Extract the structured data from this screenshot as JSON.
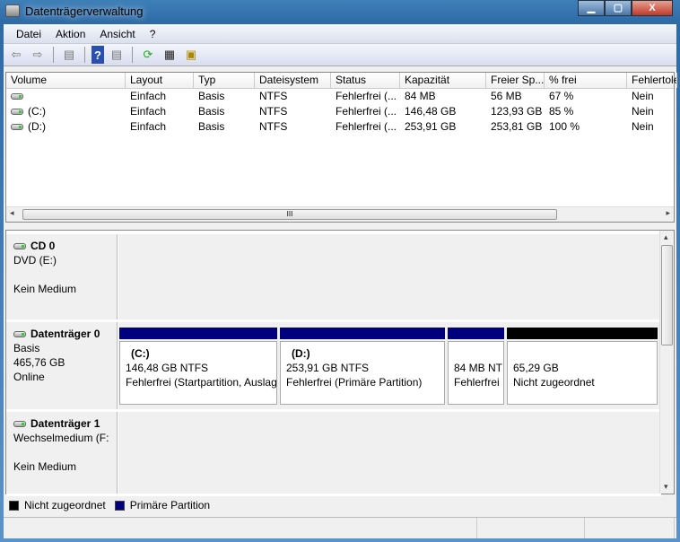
{
  "window": {
    "title": "Datenträgerverwaltung",
    "minimize": "▁",
    "maximize": "▢",
    "close": "X"
  },
  "menu": [
    "Datei",
    "Aktion",
    "Ansicht",
    "?"
  ],
  "toolbar": [
    "back-icon",
    "forward-icon",
    "show-hide-console-tree-icon",
    "help-icon",
    "show-hide-action-pane-icon",
    "refresh-icon",
    "properties-icon",
    "settings-icon"
  ],
  "table": {
    "columns": [
      "Volume",
      "Layout",
      "Typ",
      "Dateisystem",
      "Status",
      "Kapazität",
      "Freier Sp...",
      "% frei",
      "Fehlertole"
    ],
    "rows": [
      [
        "",
        "Einfach",
        "Basis",
        "NTFS",
        "Fehlerfrei (...",
        "84 MB",
        "56 MB",
        "67 %",
        "Nein"
      ],
      [
        "(C:)",
        "Einfach",
        "Basis",
        "NTFS",
        "Fehlerfrei (...",
        "146,48 GB",
        "123,93 GB",
        "85 %",
        "Nein"
      ],
      [
        "(D:)",
        "Einfach",
        "Basis",
        "NTFS",
        "Fehlerfrei (...",
        "253,91 GB",
        "253,81 GB",
        "100 %",
        "Nein"
      ]
    ],
    "scroll_grip": "III"
  },
  "disks": [
    {
      "name": "CD 0",
      "lines": [
        "DVD (E:)",
        "",
        "Kein Medium"
      ],
      "partitions": []
    },
    {
      "name": "Datenträger 0",
      "lines": [
        "Basis",
        "465,76 GB",
        "Online"
      ],
      "partitions": [
        {
          "label": "(C:)",
          "size": "146,48 GB NTFS",
          "status": "Fehlerfrei (Startpartition, Auslag",
          "color": "#00007f"
        },
        {
          "label": "(D:)",
          "size": "253,91 GB NTFS",
          "status": "Fehlerfrei (Primäre Partition)",
          "color": "#00007f"
        },
        {
          "label": "",
          "size": "84 MB NT",
          "status": "Fehlerfrei",
          "color": "#00007f"
        },
        {
          "label": "",
          "size": "65,29 GB",
          "status": "Nicht zugeordnet",
          "color": "#000000"
        }
      ]
    },
    {
      "name": "Datenträger 1",
      "lines": [
        "Wechselmedium (F:",
        "",
        "Kein Medium"
      ],
      "partitions": []
    }
  ],
  "legend": [
    {
      "label": "Nicht zugeordnet",
      "color": "#000000"
    },
    {
      "label": "Primäre Partition",
      "color": "#00007f"
    }
  ]
}
